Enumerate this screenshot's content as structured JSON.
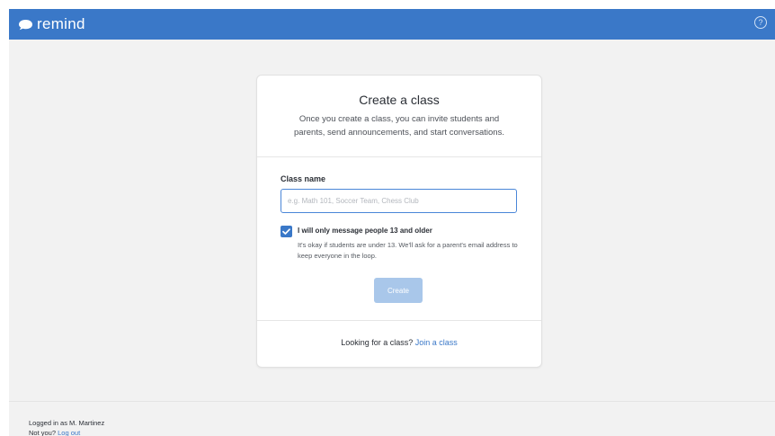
{
  "header": {
    "logo_text": "remind",
    "logo_icon": "remind-bubble-icon",
    "help_icon": "help-circle-icon",
    "help_glyph": "?",
    "background_color": "#3a78c8"
  },
  "card": {
    "title": "Create a class",
    "description": "Once you create a class, you can invite students and parents, send announcements, and start conversations.",
    "class_name_label": "Class name",
    "class_name_placeholder": "e.g. Math 101, Soccer Team, Chess Club",
    "class_name_value": "",
    "age_checkbox": {
      "checked": true,
      "label": "I will only message people 13 and older",
      "help": "It's okay if students are under 13. We'll ask for a parent's email address to keep everyone in the loop."
    },
    "create_button": "Create",
    "footer_prompt": "Looking for a class?",
    "footer_link": "Join a class"
  },
  "footer": {
    "logged_in_text": "Logged in as M. Martinez",
    "not_you_text": "Not you?",
    "logout_link": "Log out"
  },
  "colors": {
    "accent": "#3a78c8",
    "disabled_button": "#a9c7ea",
    "page_background": "#f2f2f2"
  }
}
